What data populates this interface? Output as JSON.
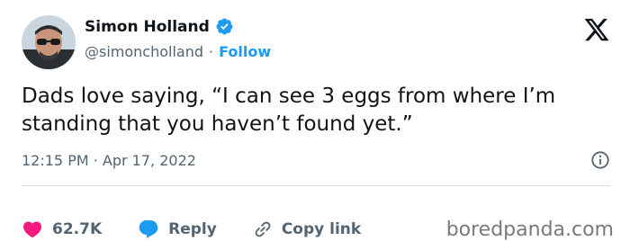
{
  "author": {
    "name": "Simon Holland",
    "handle": "@simoncholland",
    "separator": "·",
    "follow_label": "Follow",
    "verified_icon": "verified-badge-icon"
  },
  "tweet": {
    "text": "Dads love saying, “I can see 3 eggs from where I’m standing that you haven’t found yet.”",
    "timestamp": "12:15 PM · Apr 17, 2022"
  },
  "actions": {
    "like_count": "62.7K",
    "reply_label": "Reply",
    "copy_link_label": "Copy link"
  },
  "watermark": "boredpanda.com",
  "colors": {
    "link_blue": "#1d9bf0",
    "like_red": "#f91880",
    "secondary_text": "#536471",
    "primary_text": "#0f1419"
  }
}
